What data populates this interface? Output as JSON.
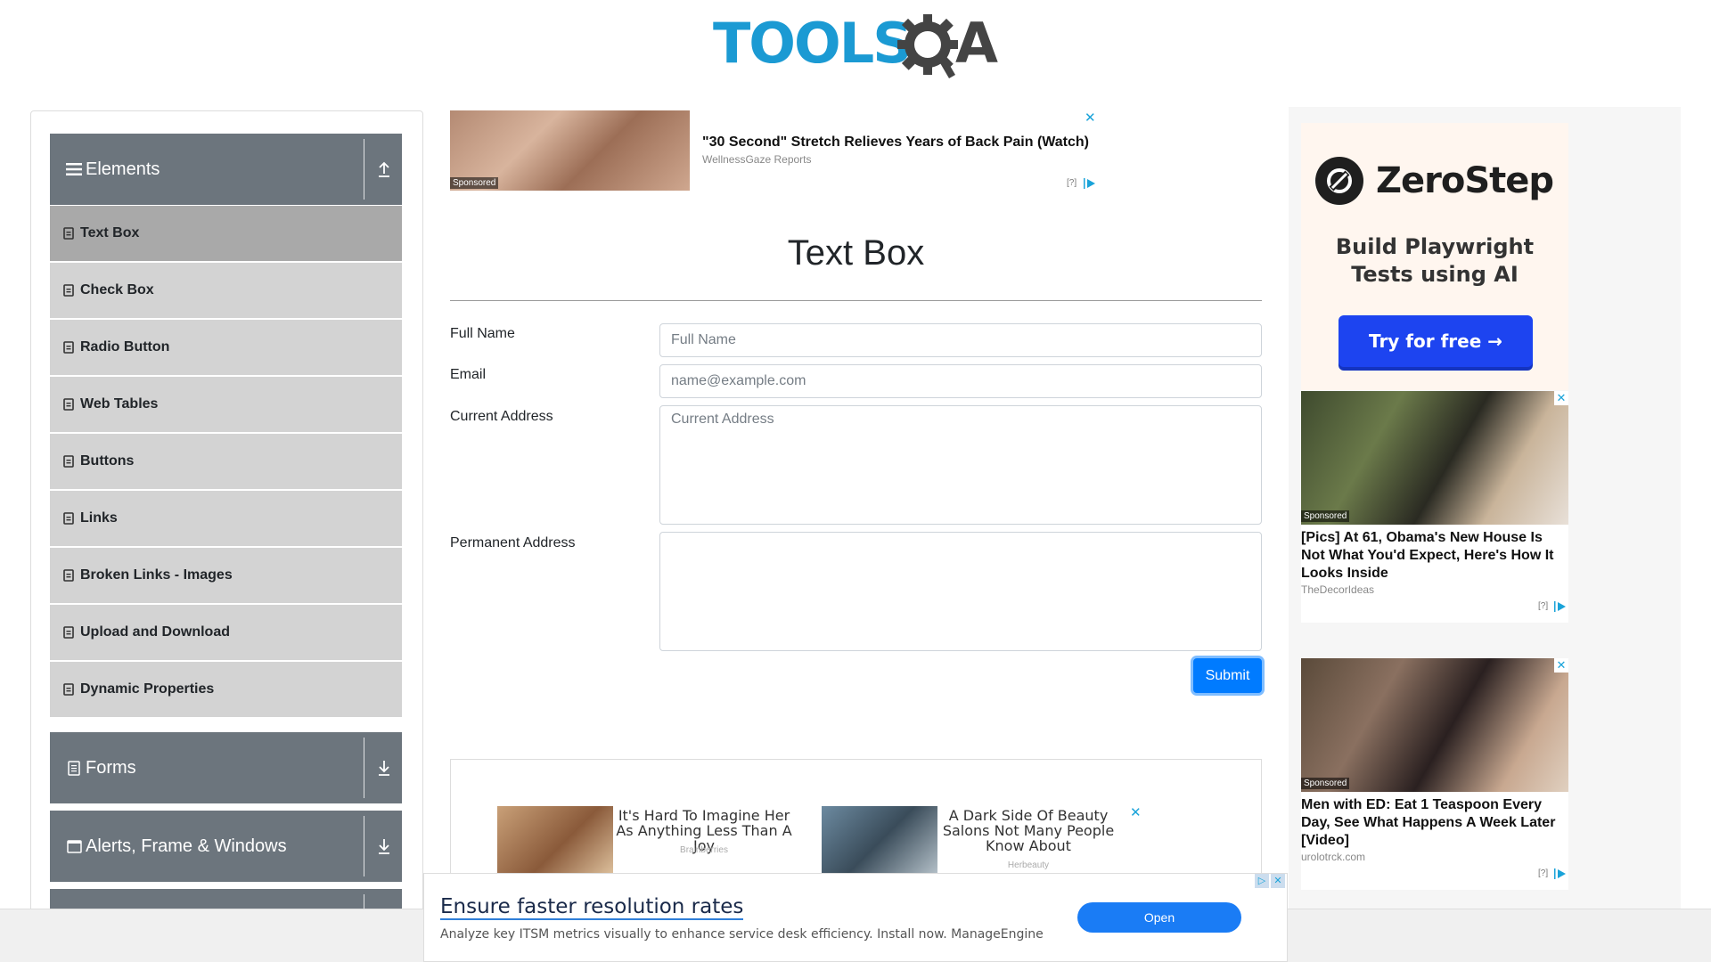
{
  "logo": {
    "part1": "TOOLS",
    "part2": "A"
  },
  "sidebar": {
    "groups": [
      {
        "title": "Elements",
        "icon": "hamburger-icon",
        "arrow": "collapse-up-icon"
      },
      {
        "title": "Forms",
        "icon": "document-icon",
        "arrow": "expand-down-icon"
      },
      {
        "title": "Alerts, Frame & Windows",
        "icon": "window-icon",
        "arrow": "expand-down-icon"
      }
    ],
    "items": [
      {
        "label": "Text Box",
        "active": true
      },
      {
        "label": "Check Box"
      },
      {
        "label": "Radio Button"
      },
      {
        "label": "Web Tables"
      },
      {
        "label": "Buttons"
      },
      {
        "label": "Links"
      },
      {
        "label": "Broken Links - Images"
      },
      {
        "label": "Upload and Download"
      },
      {
        "label": "Dynamic Properties"
      }
    ]
  },
  "top_ad": {
    "title": "\"30 Second\" Stretch Relieves Years of Back Pain (Watch)",
    "source": "WellnessGaze Reports",
    "sponsored": "Sponsored",
    "close": "✕",
    "help": "[?]"
  },
  "main": {
    "title": "Text Box",
    "form": {
      "full_name_label": "Full Name",
      "full_name_placeholder": "Full Name",
      "email_label": "Email",
      "email_placeholder": "name@example.com",
      "current_address_label": "Current Address",
      "current_address_placeholder": "Current Address",
      "permanent_address_label": "Permanent Address",
      "submit_label": "Submit"
    }
  },
  "bottom_ads": [
    {
      "title": "It's Hard To Imagine Her As Anything Less Than A Joy",
      "source": "Brainberries"
    },
    {
      "title": "A Dark Side Of Beauty Salons Not Many People Know About",
      "source": "Herbeauty"
    }
  ],
  "right_ads": {
    "zerostep": {
      "name": "ZeroStep",
      "tagline_1": "Build Playwright",
      "tagline_2": "Tests using AI",
      "button": "Try for free →"
    },
    "ad1": {
      "title": "[Pics] At 61, Obama's New House Is Not What You'd Expect, Here's How It Looks Inside",
      "source": "TheDecorIdeas",
      "sponsored": "Sponsored"
    },
    "ad2": {
      "title": "Men with ED: Eat 1 Teaspoon Every Day, See What Happens A Week Later [Video]",
      "source": "urolotrck.com",
      "sponsored": "Sponsored"
    }
  },
  "banner": {
    "title": "Ensure faster resolution rates",
    "description": "Analyze key ITSM metrics visually to enhance service desk efficiency. Install now. ManageEngine",
    "button": "Open"
  }
}
